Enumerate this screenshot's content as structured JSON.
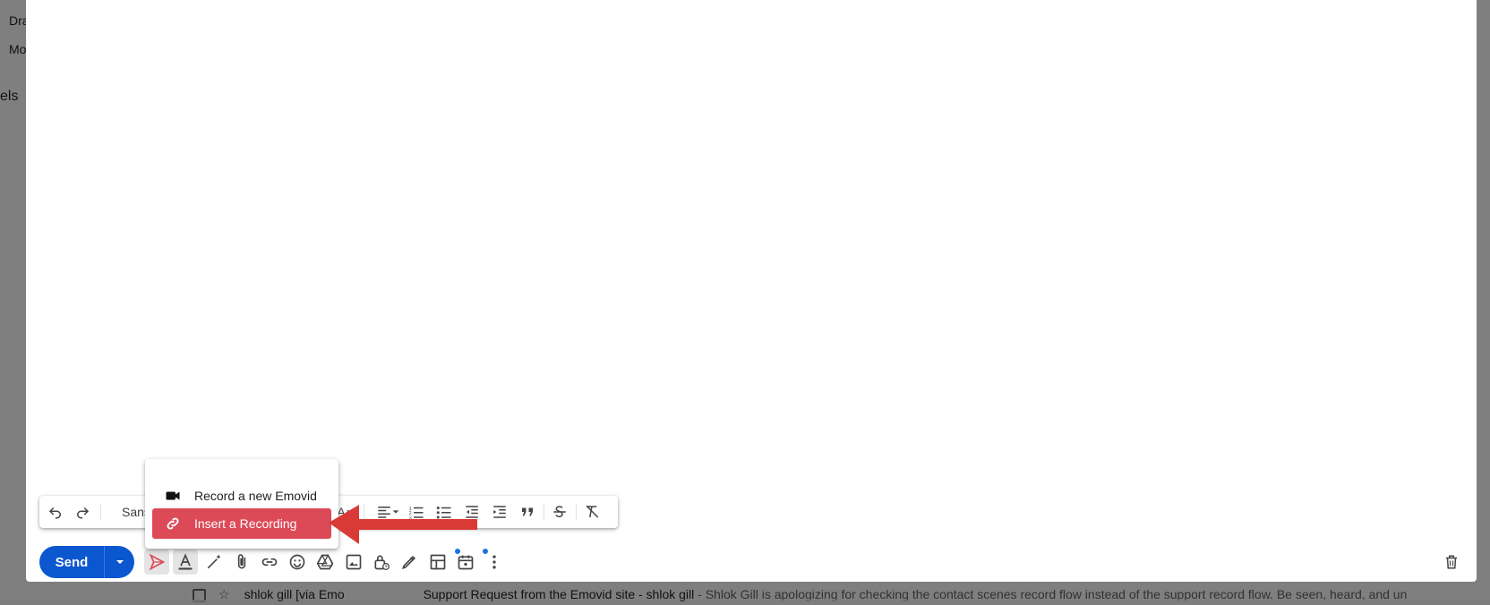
{
  "background": {
    "sidebar_items": [
      "Dra",
      "Mo",
      "els"
    ],
    "email_row": {
      "sender": "shlok gill [via Emo",
      "subject": "Support Request from the Emovid site - shlok gill",
      "snippet": " - Shlok Gill is apologizing for checking the contact scenes record flow instead of the support record flow. Be seen, heard, and un"
    }
  },
  "toolbar": {
    "font_label": "Sans S",
    "icons": [
      "undo-icon",
      "redo-icon",
      "font-selector",
      "text-color-icon",
      "align-icon",
      "numbered-list-icon",
      "bulleted-list-icon",
      "indent-less-icon",
      "indent-more-icon",
      "quote-icon",
      "strikethrough-icon",
      "remove-formatting-icon"
    ]
  },
  "actions": {
    "send_label": "Send",
    "icons": [
      "emovid-icon",
      "formatting-options-icon",
      "ai-write-icon",
      "attach-icon",
      "link-icon",
      "emoji-icon",
      "drive-icon",
      "photo-icon",
      "confidential-icon",
      "signature-icon",
      "layouts-icon",
      "schedule-icon",
      "more-options-icon",
      "discard-draft-icon"
    ]
  },
  "menu": {
    "record_label": "Record a new Emovid",
    "insert_label": "Insert a Recording"
  },
  "colors": {
    "send_blue": "#0b57d0",
    "highlight_red": "#dc4a57",
    "arrow_red": "#d93a35"
  }
}
